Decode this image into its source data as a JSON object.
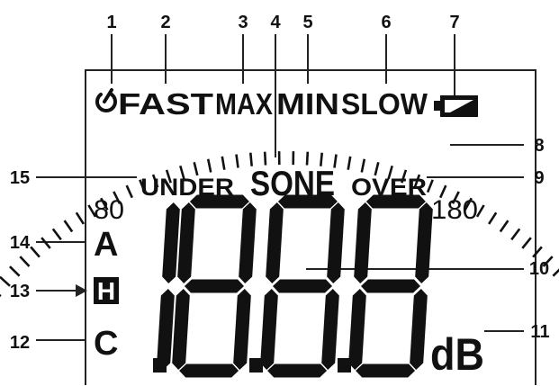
{
  "callouts": {
    "n1": "1",
    "n2": "2",
    "n3": "3",
    "n4": "4",
    "n5": "5",
    "n6": "6",
    "n7": "7",
    "n8": "8",
    "n9": "9",
    "n10": "10",
    "n11": "11",
    "n12": "12",
    "n13": "13",
    "n14": "14",
    "n15": "15"
  },
  "display": {
    "fast": "FAST",
    "max": "MAX",
    "min": "MIN",
    "slow": "SLOW",
    "under": "UNDER",
    "sone": "SONE",
    "over": "OVER",
    "range_low": "80",
    "range_high": "180",
    "weight_a": "A",
    "weight_h": "H",
    "weight_c": "C",
    "unit": "dB",
    "digits": "1.8.8.8"
  },
  "icons": {
    "power": "power-icon",
    "battery": "battery-icon",
    "bargraph": "bar-graph-scale"
  }
}
